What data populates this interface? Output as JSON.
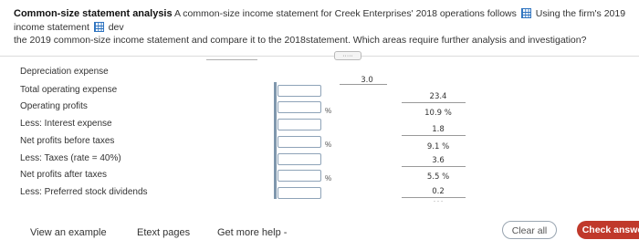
{
  "problem": {
    "title": "Common-size statement analysis",
    "text1": "A common-size income statement for Creek Enterprises' 2018 operations follows",
    "text2": "Using the firm's 2019 income statement",
    "text3": "dev",
    "text4": "the 2019 common-size income statement and compare it to the 2018statement. Which areas require further analysis and investigation?"
  },
  "more_button": "·····",
  "first_value": "3.0",
  "rows": [
    {
      "label": "Depreciation expense",
      "value": ""
    },
    {
      "label": "Total operating expense",
      "value": "23.4"
    },
    {
      "label": "Operating profits",
      "value": "10.9 %"
    },
    {
      "label": "Less: Interest expense",
      "value": "1.8"
    },
    {
      "label": "Net profits before taxes",
      "value": "9.1 %"
    },
    {
      "label": "Less: Taxes (rate = 40%)",
      "value": "3.6"
    },
    {
      "label": "Net profits after taxes",
      "value": "5.5 %"
    },
    {
      "label": "Less: Preferred stock dividends",
      "value": "0.2"
    }
  ],
  "percent_symbol": "%",
  "footer": {
    "view_example": "View an example",
    "etext_pages": "Etext pages",
    "get_more_help": "Get more help -",
    "clear_all": "Clear all",
    "check_answer": "Check answe"
  },
  "colors": {
    "check_answer_bg": "#c0392b",
    "link": "#2f74c0"
  }
}
